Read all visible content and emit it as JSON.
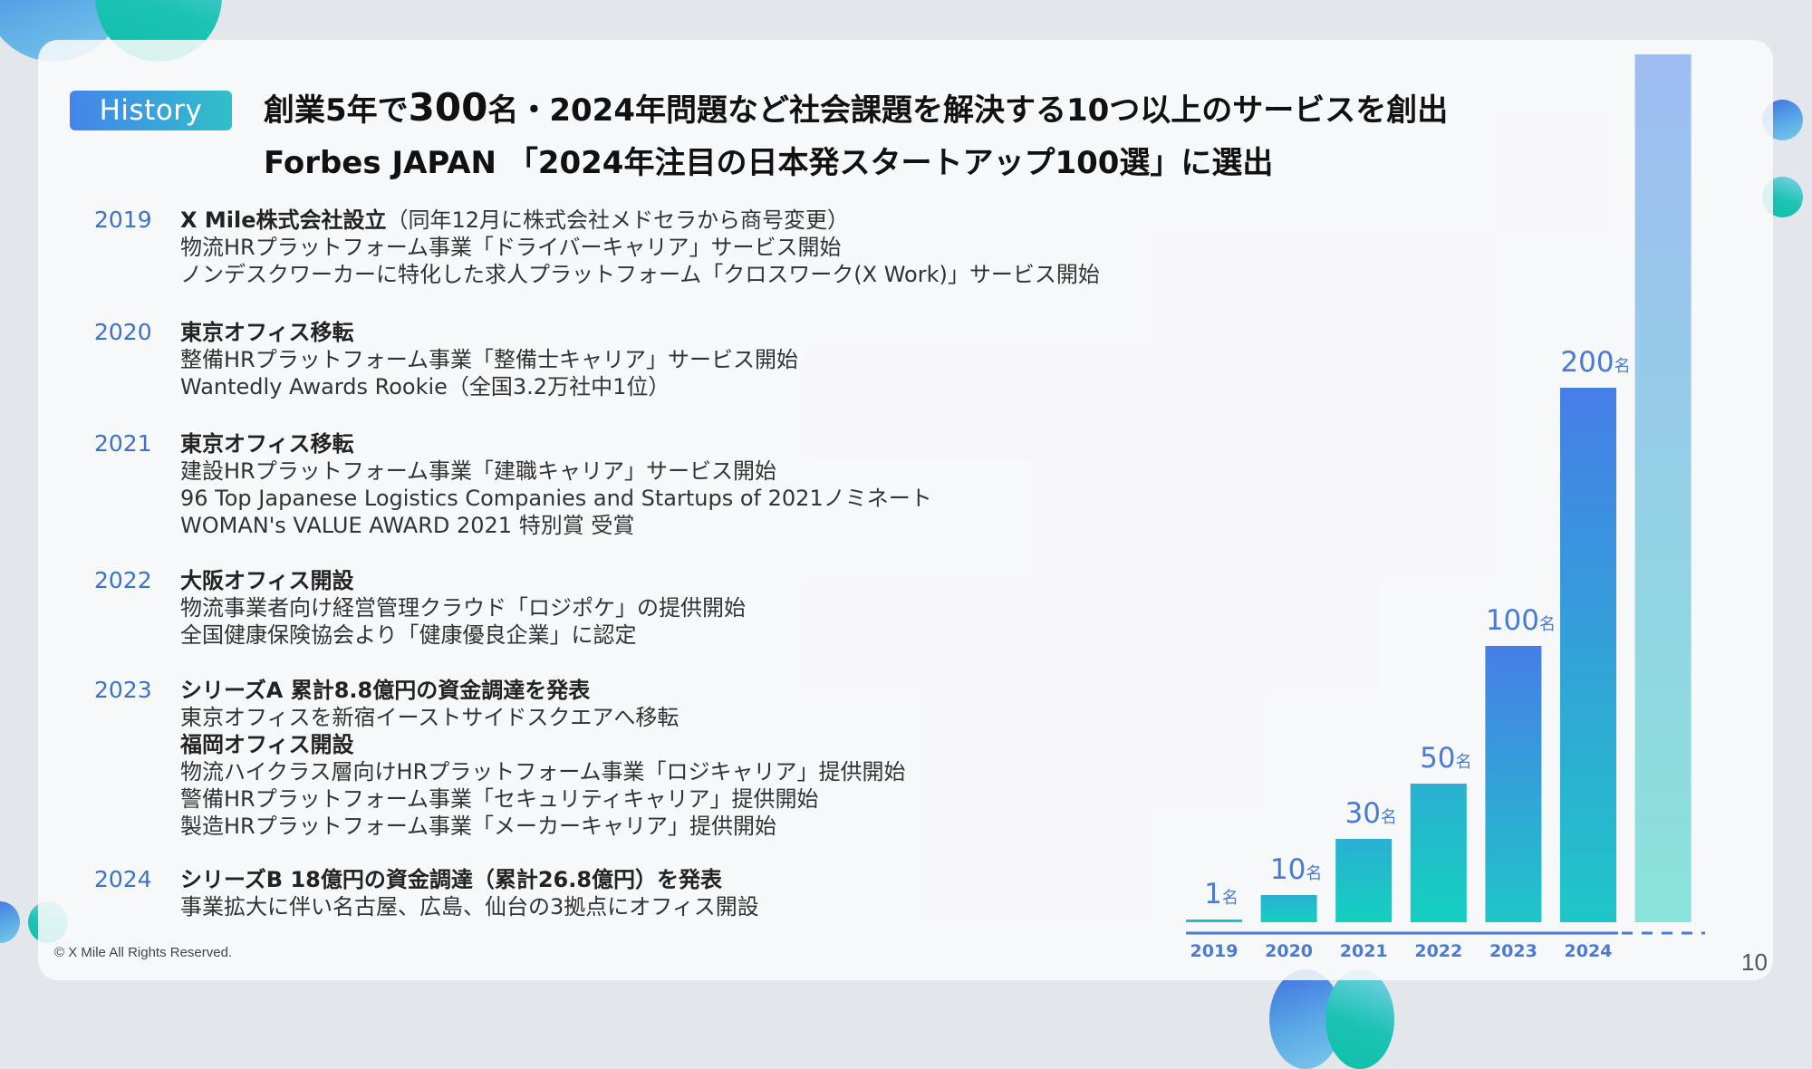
{
  "badge": "History",
  "title": {
    "line1_prefix": "創業5年で",
    "line1_big": "300",
    "line1_suffix": "名・2024年問題など社会課題を解決する10つ以上のサービスを創出",
    "line2": "Forbes JAPAN 「2024年注目の日本発スタートアップ100選」に選出"
  },
  "timeline": [
    {
      "year": "2019",
      "lines": [
        {
          "text": "X Mile株式会社設立",
          "bold": true,
          "suffix": "（同年12月に株式会社メドセラから商号変更）"
        },
        {
          "text": "物流HRプラットフォーム事業「ドライバーキャリア」サービス開始",
          "bold": false
        },
        {
          "text": "ノンデスクワーカーに特化した求人プラットフォーム「クロスワーク(X Work)」サービス開始",
          "bold": false
        }
      ]
    },
    {
      "year": "2020",
      "lines": [
        {
          "text": "東京オフィス移転",
          "bold": true
        },
        {
          "text": "整備HRプラットフォーム事業「整備士キャリア」サービス開始",
          "bold": false
        },
        {
          "text": "Wantedly Awards Rookie（全国3.2万社中1位）",
          "bold": false
        }
      ]
    },
    {
      "year": "2021",
      "lines": [
        {
          "text": "東京オフィス移転",
          "bold": true
        },
        {
          "text": "建設HRプラットフォーム事業「建職キャリア」サービス開始",
          "bold": false
        },
        {
          "text": "96 Top Japanese Logistics Companies and Startups of 2021ノミネート",
          "bold": false
        },
        {
          "text": "WOMAN's VALUE AWARD 2021 特別賞 受賞",
          "bold": false
        }
      ]
    },
    {
      "year": "2022",
      "lines": [
        {
          "text": "大阪オフィス開設",
          "bold": true
        },
        {
          "text": "物流事業者向け経営管理クラウド「ロジポケ」の提供開始",
          "bold": false
        },
        {
          "text": "全国健康保険協会より「健康優良企業」に認定",
          "bold": false
        }
      ]
    },
    {
      "year": "2023",
      "lines": [
        {
          "text": "シリーズA 累計8.8億円の資金調達を発表",
          "bold": true
        },
        {
          "text": "東京オフィスを新宿イーストサイドスクエアへ移転",
          "bold": false
        },
        {
          "text": "福岡オフィス開設",
          "bold": true
        },
        {
          "text": "物流ハイクラス層向けHRプラットフォーム事業「ロジキャリア」提供開始",
          "bold": false
        },
        {
          "text": "警備HRプラットフォーム事業「セキュリティキャリア」提供開始",
          "bold": false
        },
        {
          "text": "製造HRプラットフォーム事業「メーカーキャリア」提供開始",
          "bold": false
        }
      ]
    },
    {
      "year": "2024",
      "lines": [
        {
          "text": "シリーズB 18億円の資金調達（累計26.8億円）を発表",
          "bold": true
        },
        {
          "text": "事業拡大に伴い名古屋、広島、仙台の3拠点にオフィス開設",
          "bold": false
        }
      ]
    }
  ],
  "footer": {
    "copyright": "© X Mile All Rights Reserved.",
    "page_number": "10"
  },
  "colors": {
    "accent_blue": "#3d72c9",
    "bar_teal": "#14d0bf",
    "bar_blue": "#467ee8",
    "projection_top": "#9ebcf2",
    "projection_bottom": "#8ae3da"
  },
  "chart_data": {
    "type": "bar",
    "title": "",
    "xlabel": "",
    "ylabel": "",
    "unit": "名",
    "categories": [
      "2019",
      "2020",
      "2021",
      "2022",
      "2023",
      "2024",
      ""
    ],
    "values": [
      1,
      10,
      30,
      50,
      100,
      200,
      null
    ],
    "value_labels": [
      "1",
      "10",
      "30",
      "50",
      "100",
      "200",
      ""
    ],
    "projection_bar": {
      "category_index": 6,
      "labeled": false
    },
    "grid": false,
    "legend": "none"
  }
}
